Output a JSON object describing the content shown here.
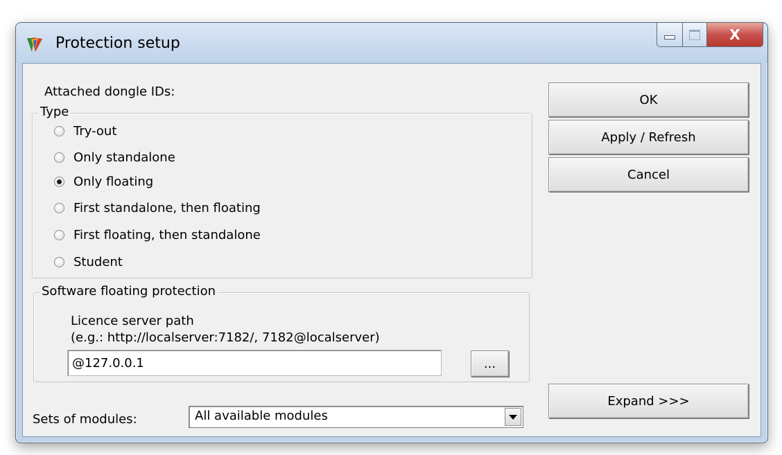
{
  "window": {
    "title": "Protection setup",
    "icon": "app-logo-icon"
  },
  "caption_buttons": {
    "minimize": "minimize-icon",
    "maximize": "maximize-icon",
    "close": "X"
  },
  "dongle": {
    "label": "Attached dongle IDs:"
  },
  "type_group": {
    "legend": "Type",
    "options": [
      {
        "label": "Try-out",
        "checked": false
      },
      {
        "label": "Only standalone",
        "checked": false
      },
      {
        "label": "Only floating",
        "checked": true
      },
      {
        "label": "First standalone, then floating",
        "checked": false
      },
      {
        "label": "First floating, then standalone",
        "checked": false
      },
      {
        "label": "Student",
        "checked": false
      }
    ]
  },
  "floating_group": {
    "legend": "Software floating protection",
    "path_label": "Licence server path",
    "path_hint": "(e.g.: http://localserver:7182/, 7182@localserver)",
    "path_value": "@127.0.0.1",
    "browse_label": "..."
  },
  "modules": {
    "label": "Sets of modules:",
    "selected": "All available modules"
  },
  "buttons": {
    "ok": "OK",
    "apply": "Apply / Refresh",
    "cancel": "Cancel",
    "expand": "Expand >>>"
  },
  "colors": {
    "close_button": "#c75050",
    "frame": "#bfd3ea",
    "client": "#f0f0f0"
  }
}
